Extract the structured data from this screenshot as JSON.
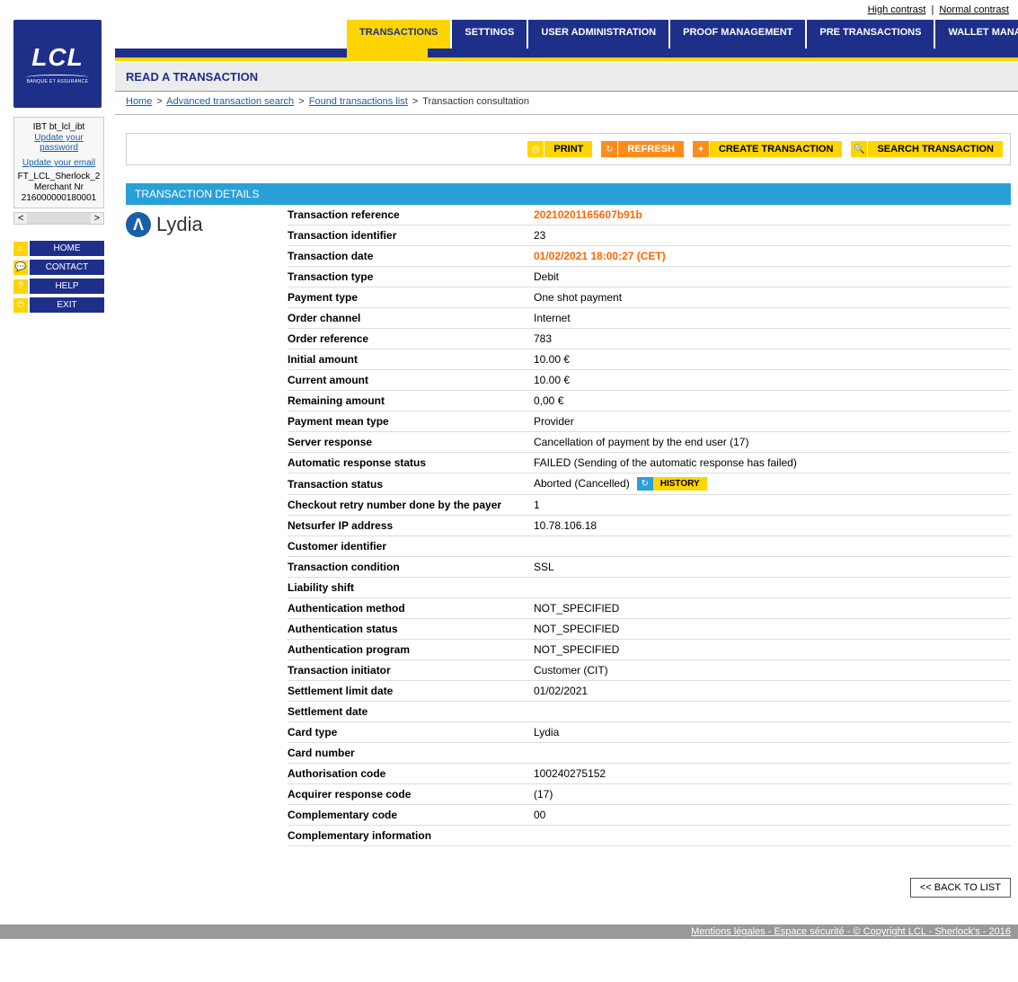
{
  "topLinks": {
    "high": "High contrast",
    "normal": "Normal contrast"
  },
  "logo": {
    "main": "LCL",
    "sub": "BANQUE ET ASSURANCE"
  },
  "tabs": [
    "TRANSACTIONS",
    "SETTINGS",
    "USER ADMINISTRATION",
    "PROOF MANAGEMENT",
    "PRE TRANSACTIONS",
    "WALLET MANAGEMENT"
  ],
  "activeTab": 0,
  "pageTitle": "READ A TRANSACTION",
  "breadcrumb": {
    "home": "Home",
    "adv": "Advanced transaction search",
    "found": "Found transactions list",
    "current": "Transaction consultation"
  },
  "user": {
    "name": "IBT bt_lcl_ibt",
    "updatePw": "Update your password",
    "updateEmail": "Update your email",
    "acct": "FT_LCL_Sherlock_2",
    "merchLbl": "Merchant Nr",
    "merchNr": "216000000180001"
  },
  "sideButtons": [
    "HOME",
    "CONTACT",
    "HELP",
    "EXIT"
  ],
  "actions": {
    "print": "PRINT",
    "refresh": "REFRESH",
    "create": "CREATE TRANSACTION",
    "search": "SEARCH TRANSACTION"
  },
  "sectionTitle": "TRANSACTION DETAILS",
  "brand": "Lydia",
  "historyBtn": "HISTORY",
  "backBtn": "<< BACK TO LIST",
  "footer": "Mentions légales - Espace sécurité - © Copyright LCL - Sherlock's - 2016",
  "rows": [
    {
      "label": "Transaction reference",
      "value": "20210201165607b91b",
      "hl": true
    },
    {
      "label": "Transaction identifier",
      "value": "23"
    },
    {
      "label": "Transaction date",
      "value": "01/02/2021 18:00:27 (CET)",
      "hl": true
    },
    {
      "label": "Transaction type",
      "value": "Debit"
    },
    {
      "label": "Payment type",
      "value": "One shot payment"
    },
    {
      "label": "Order channel",
      "value": "Internet"
    },
    {
      "label": "Order reference",
      "value": "783"
    },
    {
      "label": "Initial amount",
      "value": "10.00 €"
    },
    {
      "label": "Current amount",
      "value": "10.00 €"
    },
    {
      "label": "Remaining amount",
      "value": "0,00 €"
    },
    {
      "label": "Payment mean type",
      "value": "Provider"
    },
    {
      "label": "Server response",
      "value": "Cancellation of payment by the end user (17)"
    },
    {
      "label": "Automatic response status",
      "value": "FAILED (Sending of the automatic response has failed)"
    },
    {
      "label": "Transaction status",
      "value": "Aborted (Cancelled)",
      "history": true
    },
    {
      "label": "Checkout retry number done by the payer",
      "value": "1"
    },
    {
      "label": "Netsurfer IP address",
      "value": "10.78.106.18"
    },
    {
      "label": "Customer identifier",
      "value": ""
    },
    {
      "label": "Transaction condition",
      "value": "SSL"
    },
    {
      "label": "Liability shift",
      "value": ""
    },
    {
      "label": "Authentication method",
      "value": "NOT_SPECIFIED"
    },
    {
      "label": "Authentication status",
      "value": "NOT_SPECIFIED"
    },
    {
      "label": "Authentication program",
      "value": "NOT_SPECIFIED"
    },
    {
      "label": "Transaction initiator",
      "value": "Customer (CIT)"
    },
    {
      "label": "Settlement limit date",
      "value": "01/02/2021"
    },
    {
      "label": "Settlement date",
      "value": ""
    },
    {
      "label": "Card type",
      "value": "Lydia"
    },
    {
      "label": "Card number",
      "value": ""
    },
    {
      "label": "Authorisation code",
      "value": "100240275152"
    },
    {
      "label": "Acquirer response code",
      "value": "(17)"
    },
    {
      "label": "Complementary code",
      "value": "00"
    },
    {
      "label": "Complementary information",
      "value": ""
    }
  ]
}
